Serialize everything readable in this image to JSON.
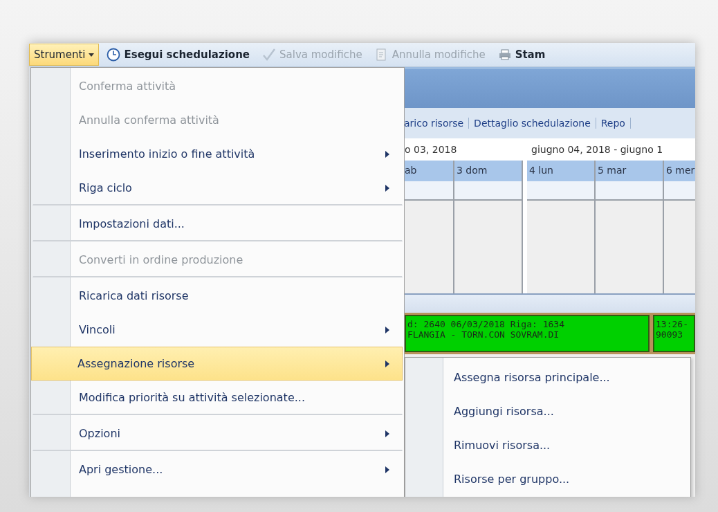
{
  "toolbar": [
    {
      "kind": "menu",
      "label": "Strumenti",
      "selected": true,
      "disabled": false
    },
    {
      "kind": "clock",
      "label": "Esegui schedulazione",
      "selected": false,
      "disabled": false
    },
    {
      "kind": "check",
      "label": "Salva modifiche",
      "selected": false,
      "disabled": true
    },
    {
      "kind": "document",
      "label": "Annulla modifiche",
      "selected": false,
      "disabled": true
    },
    {
      "kind": "printer",
      "label": "Stam",
      "selected": false,
      "disabled": false
    }
  ],
  "schedule": {
    "tabs": [
      "arico risorse",
      "Dettaglio schedulazione",
      "Repo"
    ],
    "weeks": [
      {
        "label": "o 03, 2018",
        "days": [
          "ab",
          "3 dom"
        ]
      },
      {
        "label": "giugno 04, 2018 - giugno 1",
        "days": [
          "4 lun",
          "5 mar",
          "6 mer"
        ]
      }
    ],
    "tasks": [
      {
        "lines": [
          "d: 2640 06/03/2018 Riga: 1634",
          "FLANGIA - TORN.CON SOVRAM.DI"
        ]
      },
      {
        "lines": [
          "13:26-",
          "90093"
        ]
      }
    ]
  },
  "menu": [
    {
      "label": "Conferma attività",
      "disabled": true,
      "submenu": false,
      "selected": false,
      "divider_after": false
    },
    {
      "label": "Annulla conferma attività",
      "disabled": true,
      "submenu": false,
      "selected": false,
      "divider_after": false
    },
    {
      "label": "Inserimento inizio o fine attività",
      "disabled": false,
      "submenu": true,
      "selected": false,
      "divider_after": false
    },
    {
      "label": "Riga ciclo",
      "disabled": false,
      "submenu": true,
      "selected": false,
      "divider_after": true
    },
    {
      "label": "Impostazioni dati...",
      "disabled": false,
      "submenu": false,
      "selected": false,
      "divider_after": true
    },
    {
      "label": "Converti in ordine produzione",
      "disabled": true,
      "submenu": false,
      "selected": false,
      "divider_after": true
    },
    {
      "label": "Ricarica dati risorse",
      "disabled": false,
      "submenu": false,
      "selected": false,
      "divider_after": false
    },
    {
      "label": "Vincoli",
      "disabled": false,
      "submenu": true,
      "selected": false,
      "divider_after": false
    },
    {
      "label": "Assegnazione risorse",
      "disabled": false,
      "submenu": true,
      "selected": true,
      "divider_after": false
    },
    {
      "label": "Modifica priorità su attività selezionate...",
      "disabled": false,
      "submenu": false,
      "selected": false,
      "divider_after": true
    },
    {
      "label": "Opzioni",
      "disabled": false,
      "submenu": true,
      "selected": false,
      "divider_after": true
    },
    {
      "label": "Apri gestione...",
      "disabled": false,
      "submenu": true,
      "selected": false,
      "divider_after": false
    }
  ],
  "submenu": [
    "Assegna risorsa principale...",
    "Aggiungi risorsa...",
    "Rimuovi risorsa...",
    "Risorse per gruppo..."
  ]
}
